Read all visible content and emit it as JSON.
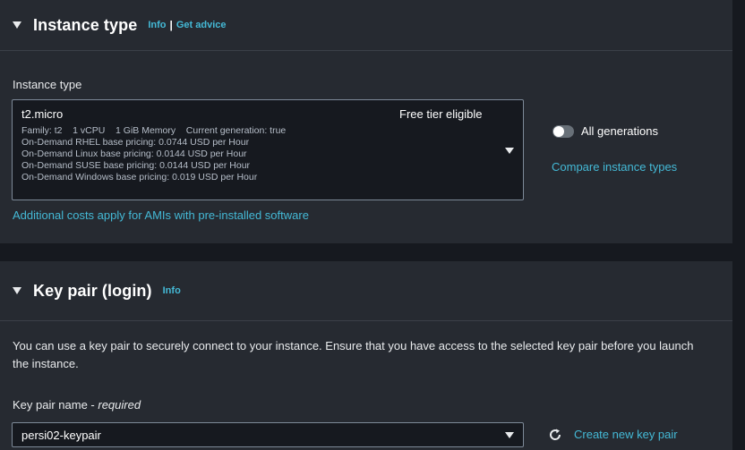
{
  "instance_panel": {
    "title": "Instance type",
    "info": "Info",
    "separator": "|",
    "advice": "Get advice",
    "field_label": "Instance type",
    "selected": {
      "name": "t2.micro",
      "badge": "Free tier eligible",
      "details": [
        "Family: t2    1 vCPU    1 GiB Memory    Current generation: true",
        "On-Demand RHEL base pricing: 0.0744 USD per Hour",
        "On-Demand Linux base pricing: 0.0144 USD per Hour",
        "On-Demand SUSE base pricing: 0.0144 USD per Hour",
        "On-Demand Windows base pricing: 0.019 USD per Hour"
      ]
    },
    "toggle_label": "All generations",
    "toggle_on": false,
    "compare_link": "Compare instance types",
    "costs_link": "Additional costs apply for AMIs with pre-installed software"
  },
  "keypair_panel": {
    "title": "Key pair (login)",
    "info": "Info",
    "description": "You can use a key pair to securely connect to your instance. Ensure that you have access to the selected key pair before you launch the instance.",
    "field_label": "Key pair name - ",
    "field_required": "required",
    "selected_value": "persi02-keypair",
    "create_link": "Create new key pair"
  },
  "colors": {
    "background": "#16191f",
    "panel": "#262a31",
    "link": "#44b9d6",
    "text": "#e9ebed"
  }
}
